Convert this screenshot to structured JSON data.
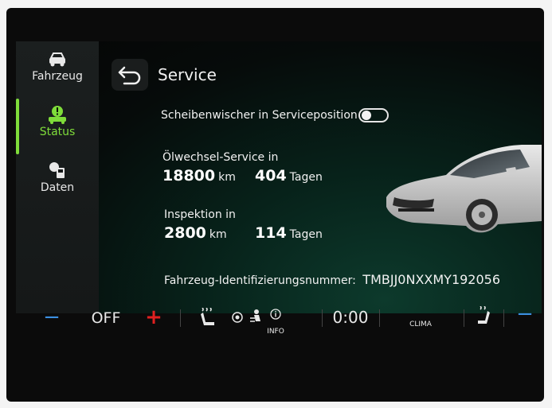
{
  "sidebar": {
    "items": [
      {
        "label": "Fahrzeug",
        "icon": "car-icon"
      },
      {
        "label": "Status",
        "icon": "car-warning-icon",
        "active": true
      },
      {
        "label": "Daten",
        "icon": "fuel-data-icon"
      }
    ]
  },
  "header": {
    "title": "Service"
  },
  "wiper": {
    "label": "Scheibenwischer in Serviceposition",
    "enabled": false
  },
  "oil_service": {
    "label": "Ölwechsel-Service in",
    "km_value": "18800",
    "km_unit": "km",
    "days_value": "404",
    "days_unit": "Tagen"
  },
  "inspection": {
    "label": "Inspektion in",
    "km_value": "2800",
    "km_unit": "km",
    "days_value": "114",
    "days_unit": "Tagen"
  },
  "vin": {
    "label": "Fahrzeug-Identifizierungsnummer:",
    "value": "TMBJJ0NXXMY192056"
  },
  "climate": {
    "left_minus": "−",
    "left_temp": "OFF",
    "left_plus": "+",
    "time": "0:00",
    "info_label": "INFO",
    "clima_label": "CLIMA",
    "right_minus": "−"
  },
  "colors": {
    "accent": "#7fdc3a",
    "minus": "#3b8fe0",
    "plus": "#e02020"
  }
}
